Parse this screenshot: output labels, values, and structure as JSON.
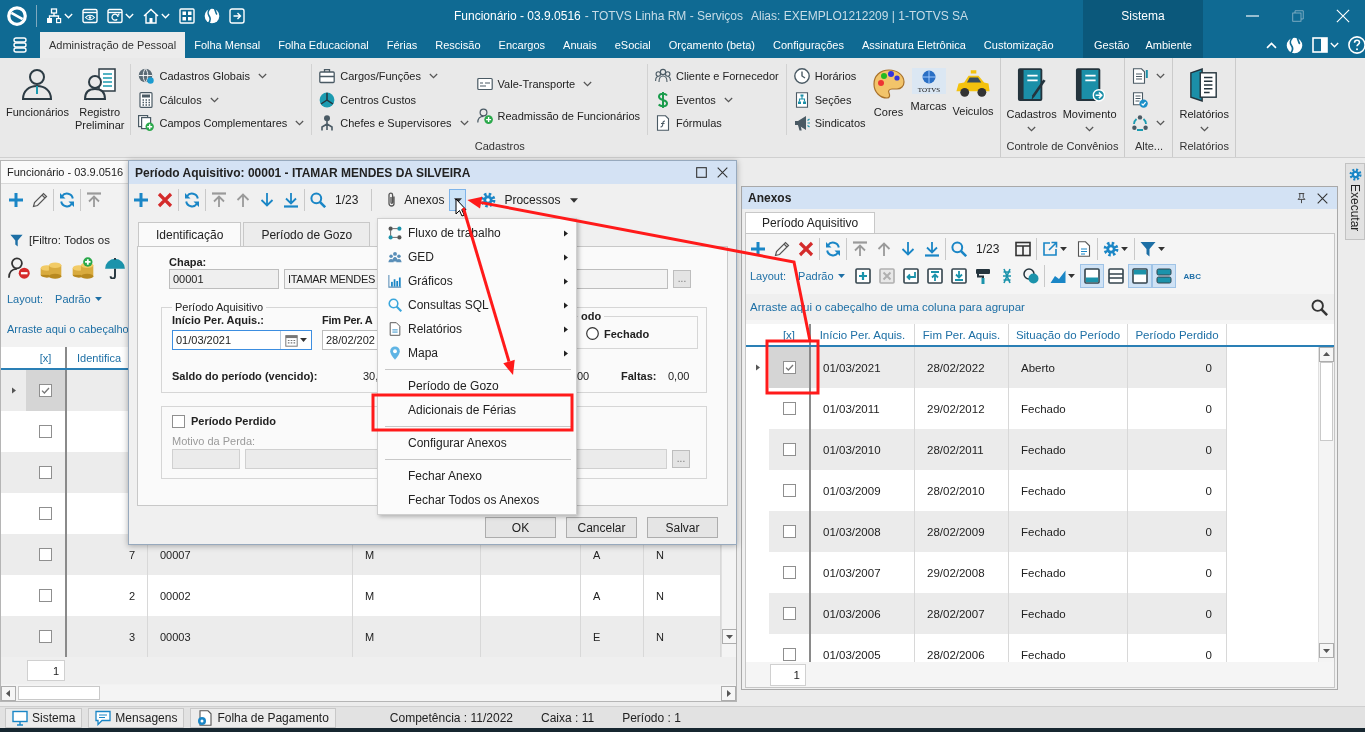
{
  "title_bar": {
    "title": "Funcionário - 03.9.0516",
    "product": "- TOTVS Linha RM - Serviços",
    "alias": "Alias: EXEMPLO1212209 | 1-TOTVS SA"
  },
  "ribbon": {
    "tabs": [
      {
        "label": "Administração de Pessoal",
        "selected": true
      },
      {
        "label": "Folha Mensal",
        "selected": false
      },
      {
        "label": "Folha Educacional",
        "selected": false
      },
      {
        "label": "Férias",
        "selected": false
      },
      {
        "label": "Rescisão",
        "selected": false
      },
      {
        "label": "Encargos",
        "selected": false
      },
      {
        "label": "Anuais",
        "selected": false
      },
      {
        "label": "eSocial",
        "selected": false
      },
      {
        "label": "Orçamento (beta)",
        "selected": false
      },
      {
        "label": "Configurações",
        "selected": false
      },
      {
        "label": "Assinatura Eletrônica",
        "selected": false
      },
      {
        "label": "Customização",
        "selected": false
      }
    ],
    "context": {
      "label": "Sistema",
      "tabs": [
        {
          "label": "Gestão",
          "selected": false
        },
        {
          "label": "Ambiente",
          "selected": false
        }
      ]
    },
    "groups": [
      {
        "label": "Cadastros",
        "panels": [
          [
            {
              "kind": "large",
              "items": [
                {
                  "label": "Funcionários",
                  "dropdown": false
                },
                {
                  "label": "Registro Preliminar",
                  "dropdown": false
                }
              ]
            }
          ],
          [
            {
              "kind": "list",
              "items": [
                {
                  "label": "Cadastros Globais",
                  "dropdown": true
                },
                {
                  "label": "Cálculos",
                  "dropdown": true
                },
                {
                  "label": "Campos Complementares",
                  "dropdown": true
                }
              ]
            }
          ],
          [
            {
              "kind": "list",
              "items": [
                {
                  "label": "Cargos/Funções",
                  "dropdown": true
                },
                {
                  "label": "Centros Custos",
                  "dropdown": false
                },
                {
                  "label": "Chefes e Supervisores",
                  "dropdown": true
                }
              ]
            },
            {
              "kind": "list",
              "items": [
                {
                  "label": "Vale-Transporte",
                  "dropdown": true
                },
                {
                  "label": "Readmissão de Funcionários",
                  "dropdown": false
                }
              ]
            }
          ],
          [
            {
              "kind": "list",
              "items": [
                {
                  "label": "Cliente e Fornecedor",
                  "dropdown": false
                },
                {
                  "label": "Eventos",
                  "dropdown": true
                },
                {
                  "label": "Fórmulas",
                  "dropdown": false
                }
              ]
            }
          ],
          [
            {
              "kind": "list",
              "items": [
                {
                  "label": "Horários",
                  "dropdown": false
                },
                {
                  "label": "Seções",
                  "dropdown": false
                },
                {
                  "label": "Sindicatos",
                  "dropdown": false
                }
              ]
            },
            {
              "kind": "large",
              "items": [
                {
                  "label": "Cores",
                  "dropdown": false
                },
                {
                  "label": "Marcas",
                  "dropdown": false,
                  "logo_text": "TOTVS"
                },
                {
                  "label": "Veiculos",
                  "dropdown": false
                }
              ]
            }
          ]
        ]
      },
      {
        "label": "Controle de Convênios",
        "panels": [
          [
            {
              "kind": "large",
              "items": [
                {
                  "label": "Cadastros",
                  "dropdown": true
                },
                {
                  "label": "Movimento",
                  "dropdown": true
                }
              ]
            }
          ]
        ]
      },
      {
        "label": "Alte...",
        "panels": [
          [
            {
              "kind": "icons",
              "items": [
                {
                  "dropdown": true
                },
                {
                  "dropdown": false
                },
                {
                  "dropdown": true
                }
              ]
            }
          ]
        ]
      },
      {
        "label": "Relatórios",
        "panels": [
          [
            {
              "kind": "large",
              "items": [
                {
                  "label": "Relatórios",
                  "dropdown": true
                }
              ]
            }
          ]
        ]
      }
    ]
  },
  "employee_window": {
    "title": "Funcionário - 03.9.0516",
    "filter": "[Filtro: Todos os",
    "layout_label": "Layout:",
    "layout_value": "Padrão",
    "group_hint": "Arraste aqui o cabeçalho",
    "check_column": "[x]",
    "columns": [
      "Identifica"
    ],
    "rows": [
      {
        "selected": true,
        "checked": true
      },
      {
        "selected": false,
        "checked": false
      },
      {
        "selected": false,
        "checked": false
      },
      {
        "selected": false,
        "checked": false
      },
      {
        "selected": false,
        "checked": false,
        "cells": [
          "7",
          "00007",
          "M",
          null,
          "A",
          "N"
        ]
      },
      {
        "selected": false,
        "checked": false,
        "cells": [
          "2",
          "00002",
          "M",
          null,
          "A",
          "N"
        ]
      },
      {
        "selected": false,
        "checked": false,
        "cells": [
          "3",
          "00003",
          "M",
          null,
          "E",
          "N"
        ]
      }
    ],
    "page": "1"
  },
  "dialog": {
    "title": "Período Aquisitivo: 00001 - ITAMAR MENDES DA SILVEIRA",
    "counter": "1/23",
    "actions": [
      {
        "label": "Anexos",
        "open": true,
        "menu": [
          {
            "kind": "submenu",
            "label": "Fluxo de trabalho",
            "annotated": false
          },
          {
            "kind": "submenu",
            "label": "GED",
            "annotated": false
          },
          {
            "kind": "submenu",
            "label": "Gráficos",
            "annotated": false
          },
          {
            "kind": "submenu",
            "label": "Consultas SQL",
            "annotated": false
          },
          {
            "kind": "submenu",
            "label": "Relatórios",
            "annotated": false
          },
          {
            "kind": "submenu",
            "label": "Mapa",
            "annotated": false
          },
          {
            "kind": "separator",
            "annotated": false
          },
          {
            "kind": "item",
            "label": "Período de Gozo",
            "annotated": false
          },
          {
            "kind": "item",
            "label": "Adicionais de Férias",
            "annotated": true
          },
          {
            "kind": "separator",
            "annotated": false
          },
          {
            "kind": "item",
            "label": "Configurar Anexos",
            "annotated": false
          },
          {
            "kind": "separator",
            "annotated": false
          },
          {
            "kind": "item",
            "label": "Fechar Anexo",
            "annotated": false
          },
          {
            "kind": "item",
            "label": "Fechar Todos os Anexos",
            "annotated": false
          }
        ]
      },
      {
        "label": "Processos",
        "open": false
      }
    ],
    "tabs": [
      {
        "label": "Identificação",
        "selected": true
      },
      {
        "label": "Período de Gozo",
        "selected": false
      }
    ],
    "chapa": {
      "label": "Chapa:",
      "code": "00001",
      "name": "ITAMAR MENDES",
      "lookup": "..."
    },
    "period": {
      "legend": "Período Aquisitivo",
      "start_label": "Início Per. Aquis.:",
      "start_value": "01/03/2021",
      "end_label": "Fim Per. A",
      "end_value": "28/02/202",
      "status_legend": "odo",
      "status_option": {
        "label": "Fechado",
        "selected": false
      },
      "balance_label": "Saldo do período (vencido):",
      "balance_value": "30,",
      "column_value": "00",
      "absences_label": "Faltas:",
      "absences_value": "0,00"
    },
    "lost": {
      "label": "Período Perdido",
      "checked": false,
      "reason_label": "Motivo da Perda:",
      "lookup": "..."
    },
    "buttons": [
      "OK",
      "Cancelar",
      "Salvar"
    ]
  },
  "attachments_panel": {
    "title": "Anexos",
    "tabs": [
      {
        "label": "Período Aquisitivo",
        "selected": true
      }
    ],
    "counter": "1/23",
    "layout_label": "Layout:",
    "layout_value": "Padrão",
    "view_toggles": [
      {
        "on": true
      },
      {
        "on": false
      },
      {
        "on": true
      },
      {
        "on": true
      }
    ],
    "spell_label": "ABC",
    "group_hint": "Arraste aqui o cabeçalho de uma coluna para agrupar",
    "check_column": "[x]",
    "columns": [
      "Início Per. Aquis.",
      "Fim Per. Aquis.",
      "Situação do Período",
      "Período Perdido"
    ],
    "rows": [
      {
        "selected": true,
        "checked": true,
        "annotated": true,
        "cells": [
          "01/03/2021",
          "28/02/2022",
          "Aberto",
          "0"
        ]
      },
      {
        "selected": false,
        "checked": false,
        "annotated": false,
        "cells": [
          "01/03/2011",
          "29/02/2012",
          "Fechado",
          "0"
        ]
      },
      {
        "selected": false,
        "checked": false,
        "annotated": false,
        "cells": [
          "01/03/2010",
          "28/02/2011",
          "Fechado",
          "0"
        ]
      },
      {
        "selected": false,
        "checked": false,
        "annotated": false,
        "cells": [
          "01/03/2009",
          "28/02/2010",
          "Fechado",
          "0"
        ]
      },
      {
        "selected": false,
        "checked": false,
        "annotated": false,
        "cells": [
          "01/03/2008",
          "28/02/2009",
          "Fechado",
          "0"
        ]
      },
      {
        "selected": false,
        "checked": false,
        "annotated": false,
        "cells": [
          "01/03/2007",
          "29/02/2008",
          "Fechado",
          "0"
        ]
      },
      {
        "selected": false,
        "checked": false,
        "annotated": false,
        "cells": [
          "01/03/2006",
          "28/02/2007",
          "Fechado",
          "0"
        ]
      },
      {
        "selected": false,
        "checked": false,
        "annotated": false,
        "cells": [
          "01/03/2005",
          "28/02/2006",
          "Fechado",
          "0"
        ]
      }
    ],
    "page": "1"
  },
  "side_tab": {
    "label": "Executar"
  },
  "status_bar": {
    "buttons": [
      "Sistema",
      "Mensagens",
      "Folha de Pagamento"
    ],
    "fields": [
      "Competência : 11/2022",
      "Caixa : 11",
      "Período : 1"
    ]
  }
}
